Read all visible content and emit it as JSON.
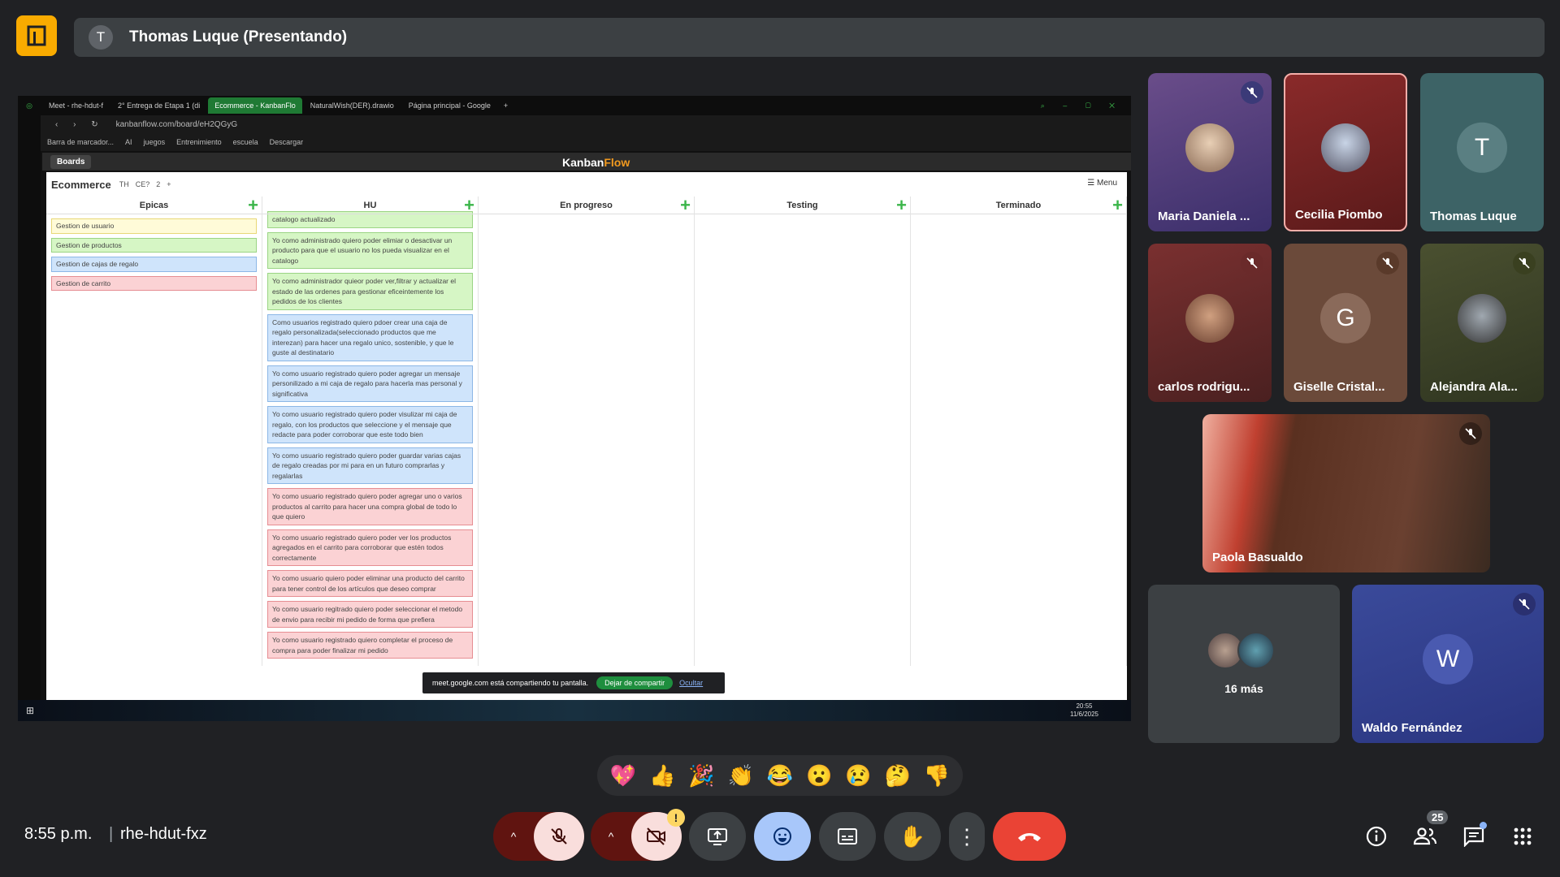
{
  "presenter": {
    "avatar_letter": "T",
    "name": "Thomas Luque (Presentando)"
  },
  "browser": {
    "tabs": [
      "Meet - rhe-hdut-f",
      "2° Entrega de Etapa 1 (di",
      "Ecommerce - KanbanFlo",
      "NaturalWish(DER).drawio",
      "Página principal - Google"
    ],
    "url": "kanbanflow.com/board/eH2QGyG",
    "bookmarks": [
      "Barra de marcador...",
      "AI",
      "juegos",
      "Entrenimiento",
      "escuela",
      "Descargar"
    ]
  },
  "kanban": {
    "boards_label": "Boards",
    "logo_a": "Kanban",
    "logo_b": "Flow",
    "board_title": "Ecommerce",
    "chips": [
      "TH",
      "CE?",
      "2",
      "+"
    ],
    "menu_label": "Menu",
    "columns": [
      {
        "title": "Epicas",
        "cards": [
          {
            "text": "Gestion de usuario",
            "color": "y"
          },
          {
            "text": "Gestion de productos",
            "color": "g"
          },
          {
            "text": "Gestion de cajas de regalo",
            "color": "b"
          },
          {
            "text": "Gestion de carrito",
            "color": "r"
          }
        ]
      },
      {
        "title": "HU",
        "cards": [
          {
            "text": "catalogo actualizado",
            "color": "g"
          },
          {
            "text": "Yo como administrado quiero poder elimiar o desactivar un producto para que el usuario no los pueda visualizar en el catalogo",
            "color": "g"
          },
          {
            "text": "Yo como administrador quieor poder ver,filtrar y actualizar el estado de las ordenes para gestionar eficeintemente los pedidos de los clientes",
            "color": "g"
          },
          {
            "text": "Como usuarios registrado quiero pdoer crear una caja de regalo personalizada(seleccionado productos que me interezan) para hacer una regalo unico, sostenible, y que le guste al destinatario",
            "color": "b"
          },
          {
            "text": "Yo como usuario registrado quiero poder agregar un mensaje personilizado a mi caja de regalo para hacerla mas personal y significativa",
            "color": "b"
          },
          {
            "text": "Yo como usuario registrado quiero poder visulizar mi caja de regalo, con los productos que seleccione y el mensaje que redacte para poder corroborar que este todo bien",
            "color": "b"
          },
          {
            "text": "Yo como usuario registrado quiero poder guardar varias cajas de regalo creadas por mi para en un futuro comprarlas y regalarlas",
            "color": "b"
          },
          {
            "text": "Yo como usuario registrado quiero poder agregar uno o varios productos al carrito para hacer una compra global de todo lo que quiero",
            "color": "r"
          },
          {
            "text": "Yo como usuario registrado quiero poder ver los productos agregados en el carrito para corroborar que estén todos correctamente",
            "color": "r"
          },
          {
            "text": "Yo como usuario quiero poder eliminar una producto del carrito para tener control de los artículos que deseo comprar",
            "color": "r"
          },
          {
            "text": "Yo como usuario regitrado quiero poder seleccionar el metodo de envio para recibir mi pedido de forma que prefiera",
            "color": "r"
          },
          {
            "text": "Yo como usuario registrado quiero completar el proceso de compra para poder finalizar mi pedido",
            "color": "r"
          }
        ]
      },
      {
        "title": "En progreso",
        "cards": []
      },
      {
        "title": "Testing",
        "cards": []
      },
      {
        "title": "Terminado",
        "cards": []
      }
    ]
  },
  "share_banner": {
    "text": "meet.google.com está compartiendo tu pantalla.",
    "stop": "Dejar de compartir",
    "hide": "Ocultar"
  },
  "taskbar": {
    "time": "20:55",
    "date": "11/6/2025"
  },
  "participants": [
    {
      "name": "Maria Daniela ...",
      "muted": true
    },
    {
      "name": "Cecilia Piombo",
      "muted": false
    },
    {
      "name": "Thomas Luque",
      "letter": "T",
      "muted": false
    },
    {
      "name": "carlos rodrigu...",
      "muted": true
    },
    {
      "name": "Giselle Cristal...",
      "letter": "G",
      "muted": true
    },
    {
      "name": "Alejandra Ala...",
      "muted": true
    },
    {
      "name": "Paola Basualdo",
      "muted": true
    },
    {
      "name": "16 más"
    },
    {
      "name": "Waldo Fernández",
      "letter": "W",
      "muted": true
    }
  ],
  "reactions": [
    "💖",
    "👍",
    "🎉",
    "👏",
    "😂",
    "😮",
    "😢",
    "🤔",
    "👎"
  ],
  "meeting": {
    "time": "8:55 p.m.",
    "separator": "|",
    "code": "rhe-hdut-fxz",
    "participant_count": "25",
    "camera_warning": "!"
  },
  "colors": {
    "bg": "#202124",
    "end_call": "#ea4335",
    "muted_red": "#f9dedc",
    "accent_blue": "#a8c7fa",
    "kanban_green": "#3bb54a"
  }
}
